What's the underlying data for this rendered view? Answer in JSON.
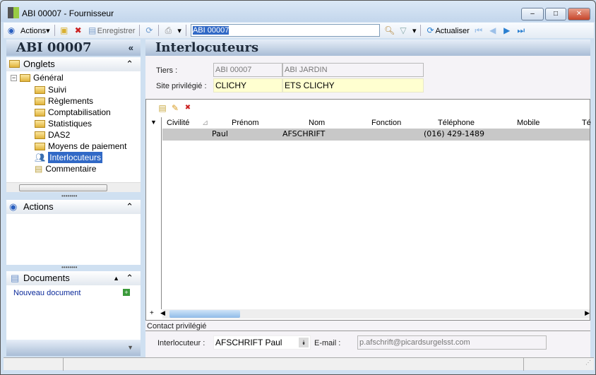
{
  "window": {
    "title": "ABI 00007 -  Fournisseur",
    "minimize": "–",
    "maximize": "□",
    "close": "✕"
  },
  "toolbar": {
    "actions": "Actions",
    "save": "Enregistrer",
    "search_value": "ABI 00007",
    "refresh": "Actualiser"
  },
  "left": {
    "title": "ABI 00007",
    "collapse": "«",
    "onglets": {
      "title": "Onglets",
      "items": [
        "Général",
        "Suivi",
        "Règlements",
        "Comptabilisation",
        "Statistiques",
        "DAS2",
        "Moyens de paiement",
        "Interlocuteurs",
        "Commentaire"
      ],
      "selected": "Interlocuteurs"
    },
    "actions": {
      "title": "Actions"
    },
    "documents": {
      "title": "Documents",
      "new": "Nouveau document"
    }
  },
  "main": {
    "title": "Interlocuteurs",
    "tiers_label": "Tiers :",
    "tiers_code": "ABI 00007",
    "tiers_name": "ABI JARDIN",
    "site_label": "Site privilégié :",
    "site_code": "CLICHY",
    "site_name": "ETS CLICHY",
    "grid": {
      "columns": [
        "Civilité",
        "Prénom",
        "Nom",
        "Fonction",
        "Téléphone",
        "Mobile",
        "Té"
      ],
      "rows": [
        {
          "civilite": "",
          "prenom": "Paul",
          "nom": "AFSCHRIFT",
          "fonction": "",
          "telephone": "(016) 429-1489",
          "mobile": ""
        }
      ]
    },
    "contact": {
      "legend": "Contact privilégié",
      "interlocuteur_label": "Interlocuteur :",
      "interlocuteur": "AFSCHRIFT Paul",
      "email_label": "E-mail :",
      "email": "p.afschrift@picardsurgelsst.com"
    }
  },
  "colors": {
    "selection": "#3169c6",
    "highlight_field": "#ffffd0",
    "row_selected": "#c8c8c8"
  }
}
